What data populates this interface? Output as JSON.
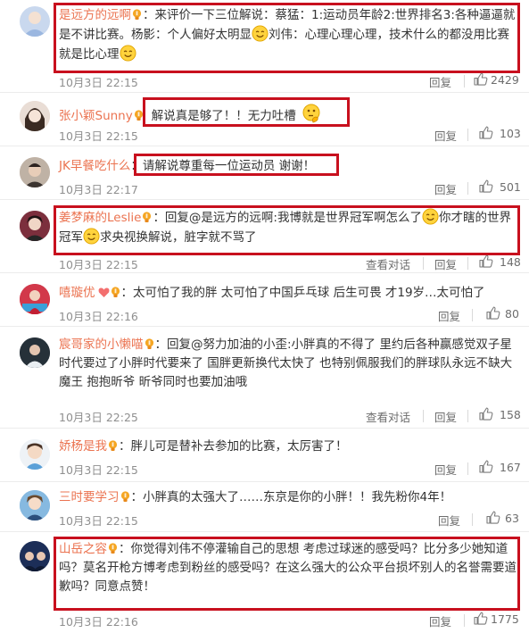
{
  "actions": {
    "reply": "回复",
    "view_conversation": "查看对话"
  },
  "comments": [
    {
      "user": "是远方的远啊",
      "parts": [
        "：来评价一下三位解说：蔡猛：1:运动员年龄2:世界排名3:各种逼逼就是不讲比赛。杨影：个人偏好太明显",
        "刘伟：心理心理心理，技术什么的都没用比赛就是比心理"
      ],
      "time": "10月3日 22:15",
      "likes": "2429"
    },
    {
      "user": "张小颖Sunny",
      "parts": [
        "解说真是够了！！无力吐槽"
      ],
      "time": "10月3日 22:15",
      "likes": "103"
    },
    {
      "user": "JK早餐吃什么",
      "parts": [
        "：请解说尊重每一位运动员 谢谢！"
      ],
      "time": "10月3日 22:17",
      "likes": "501"
    },
    {
      "user": "姜梦麻的Leslie",
      "parts": [
        "：回复@是远方的远啊:我博就是世界冠军啊怎么了",
        "你才瞎的世界冠军",
        "求央视换解说，脏字就不骂了"
      ],
      "time": "10月3日 22:15",
      "likes": "148"
    },
    {
      "user": "嘻璇优",
      "parts": [
        "：太可怕了我的胖 太可怕了中国乒乓球 后生可畏 才19岁…太可怕了"
      ],
      "time": "10月3日 22:16",
      "likes": "80"
    },
    {
      "user": "宸哥家的小懒喵",
      "parts": [
        "：回复@努力加油的小歪:小胖真的不得了 里约后各种赢感觉双子星时代要过了小胖时代要来了 国胖更新换代太快了 也特别佩服我们的胖球队永远不缺大魔王 抱抱昕爷 昕爷同时也要加油哦"
      ],
      "time": "10月3日 22:25",
      "likes": "158"
    },
    {
      "user": "娇杨是我",
      "parts": [
        "：胖儿可是替补去参加的比赛，太厉害了！"
      ],
      "time": "10月3日 22:15",
      "likes": "167"
    },
    {
      "user": "三时要学习",
      "parts": [
        "：小胖真的太强大了……东京是你的小胖！！我先粉你4年！"
      ],
      "time": "10月3日 22:15",
      "likes": "63"
    },
    {
      "user": "山岳之容",
      "parts": [
        "：你觉得刘伟不停灌输自己的思想 考虑过球迷的感受吗？比分多少她知道吗？莫名开枪方博考虑到粉丝的感受吗？在这么强大的公众平台损坏别人的名誉需要道歉吗？同意点赞！"
      ],
      "time": "10月3日 22:16",
      "likes": "1775"
    }
  ]
}
